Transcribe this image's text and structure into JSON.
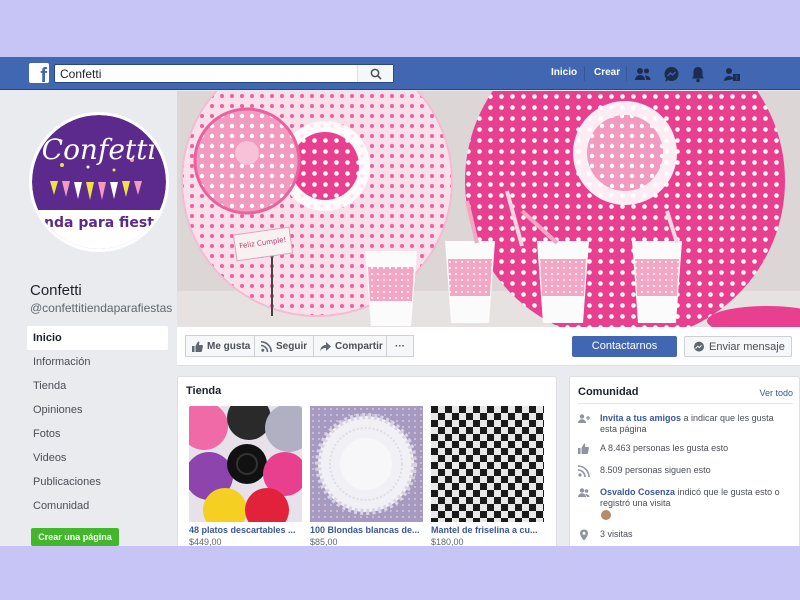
{
  "header": {
    "search_value": "Confetti",
    "nav": [
      "Inicio",
      "Crear"
    ]
  },
  "page": {
    "name": "Confetti",
    "handle": "@confettitiendaparafiestas",
    "logo_text": "Confetti",
    "logo_subtext": "nda para fiest"
  },
  "sidebar": {
    "items": [
      "Inicio",
      "Información",
      "Tienda",
      "Opiniones",
      "Fotos",
      "Videos",
      "Publicaciones",
      "Comunidad"
    ],
    "active_index": 0,
    "create_label": "Crear una página"
  },
  "cover": {
    "sign_text": "Feliz Cumple!"
  },
  "actions": {
    "like": "Me gusta",
    "follow": "Seguir",
    "share": "Compartir",
    "more": "···",
    "contact": "Contactarnos",
    "message": "Enviar mensaje"
  },
  "shop": {
    "title": "Tienda",
    "products": [
      {
        "name": "48 platos descartables ...",
        "price": "$449,00"
      },
      {
        "name": "100 Blondas blancas de...",
        "price": "$85,00"
      },
      {
        "name": "Mantel de friselina a cu...",
        "price": "$180,00"
      }
    ]
  },
  "community": {
    "title": "Comunidad",
    "see_all": "Ver todo",
    "invite_link": "Invita a tus amigos",
    "invite_rest": " a indicar que les gusta esta página",
    "likes": "A 8.463 personas les gusta esto",
    "follows": "8.509 personas siguen esto",
    "visitor_name": "Osvaldo Cosenza",
    "visitor_rest": " indicó que le gusta esto o registró una visita",
    "visits": "3 visitas"
  },
  "colors": {
    "brand_blue": "#4267b2",
    "green": "#42b72a",
    "logo_purple": "#5b2a8c",
    "pink": "#e8408f"
  }
}
